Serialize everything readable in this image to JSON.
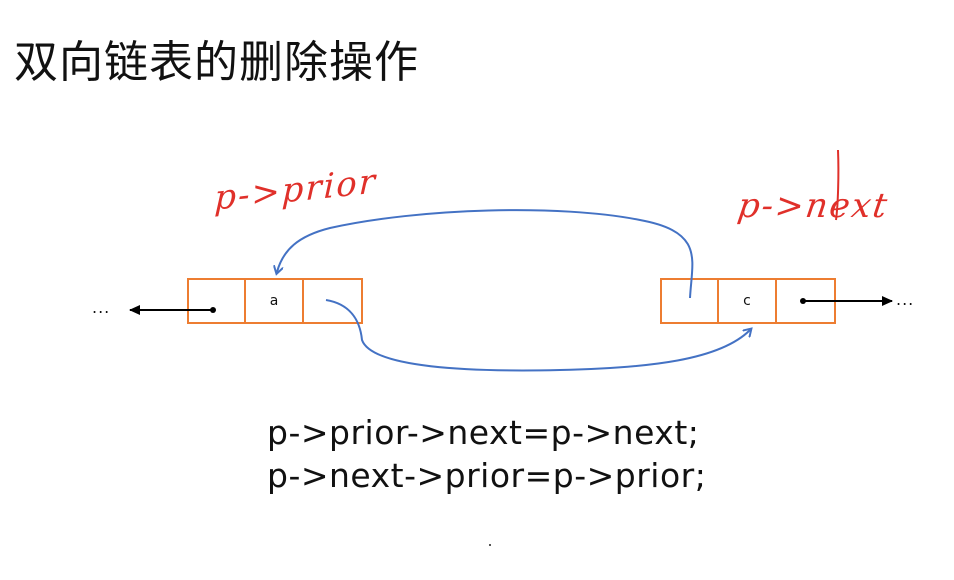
{
  "title": "双向链表的删除操作",
  "annotations": {
    "prior_label": "p->prior",
    "next_label": "p->next"
  },
  "nodes": {
    "a": {
      "cells": [
        "",
        "a",
        ""
      ]
    },
    "c": {
      "cells": [
        "",
        "c",
        ""
      ]
    }
  },
  "ellipsis": {
    "left": "...",
    "right": "..."
  },
  "code": {
    "line1": "p->prior->next=p->next;",
    "line2": "p->next->prior=p->prior;"
  },
  "colors": {
    "node_border": "#ed7d31",
    "arrow_blue": "#4472c4",
    "handwriting_red": "#e0302a",
    "pointer_black": "#000000"
  }
}
